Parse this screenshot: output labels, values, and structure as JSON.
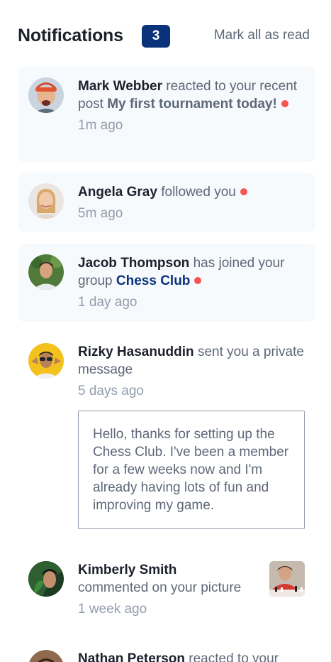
{
  "header": {
    "title": "Notifications",
    "unread_count": "3",
    "mark_all_label": "Mark all as read"
  },
  "notifications": [
    {
      "name": "Mark Webber",
      "action": "reacted to your recent post",
      "target": "My first tournament today!",
      "time": "1m ago",
      "unread": true
    },
    {
      "name": "Angela Gray",
      "action": "followed you",
      "time": "5m ago",
      "unread": true
    },
    {
      "name": "Jacob Thompson",
      "action": "has joined your group",
      "target": "Chess Club",
      "time": "1 day ago",
      "unread": true
    },
    {
      "name": "Rizky Hasanuddin",
      "action": "sent you a private message",
      "time": "5 days ago",
      "unread": false,
      "message": "Hello, thanks for setting up the Chess Club. I've been a member for a few weeks now and I'm already having lots of fun and improving my game."
    },
    {
      "name": "Kimberly Smith",
      "action": "commented on your picture",
      "time": "1 week ago",
      "unread": false
    },
    {
      "name": "Nathan Peterson",
      "action": "reacted to your",
      "unread": false
    }
  ],
  "colors": {
    "unread_dot": "#f65552",
    "badge": "#0a327b",
    "card_bg": "#f7fafd"
  }
}
